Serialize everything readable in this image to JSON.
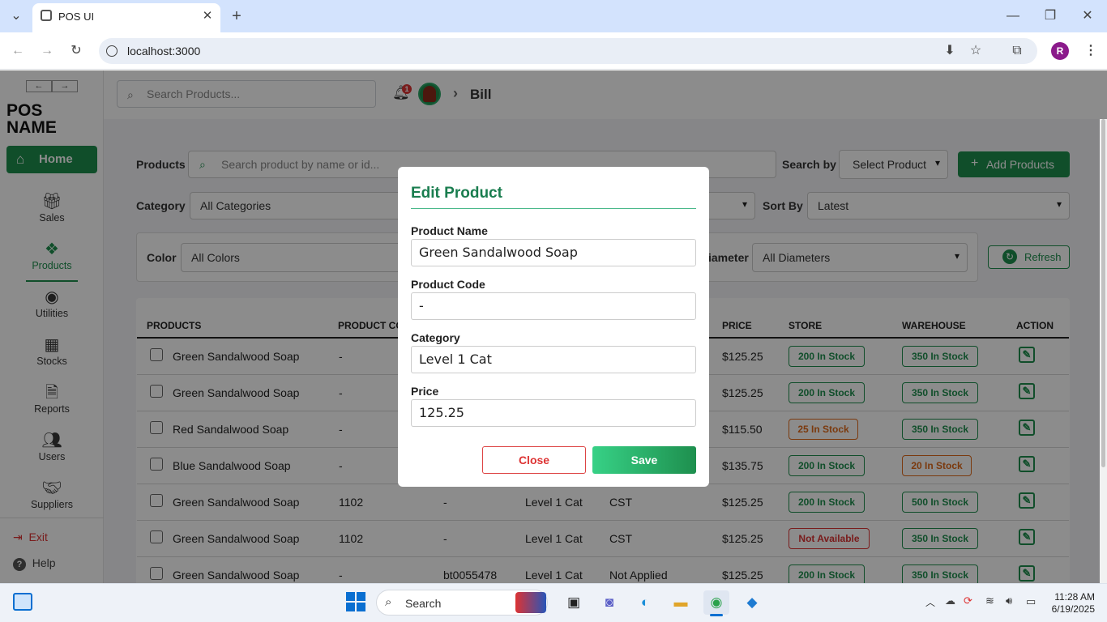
{
  "browser": {
    "tab_title": "POS UI",
    "url": "localhost:3000",
    "profile_initial": "R"
  },
  "sidebar": {
    "logo_line1": "POS",
    "logo_line2": "NAME",
    "home_label": "Home",
    "items": [
      {
        "label": "Sales",
        "icon": "gift-box-icon"
      },
      {
        "label": "Products",
        "icon": "cubes-icon"
      },
      {
        "label": "Utilities",
        "icon": "gauge-icon"
      },
      {
        "label": "Stocks",
        "icon": "boxes-icon"
      },
      {
        "label": "Reports",
        "icon": "document-icon"
      },
      {
        "label": "Users",
        "icon": "users-icon"
      },
      {
        "label": "Suppliers",
        "icon": "handshake-icon"
      }
    ],
    "exit_label": "Exit",
    "help_label": "Help"
  },
  "topbar": {
    "search_placeholder": "Search Products...",
    "notification_count": "1",
    "breadcrumb": "Bill"
  },
  "filters": {
    "products_label": "Products",
    "search_placeholder": "Search product by name or id...",
    "search_by_label": "Search by",
    "search_by_value": "Select Product",
    "add_button": "Add Products",
    "category_label": "Category",
    "category_value": "All Categories",
    "sort_label": "Sort By",
    "sort_value": "Latest",
    "color_label": "Color",
    "color_value": "All Colors",
    "diameter_label": "iameter",
    "diameter_value": "All Diameters",
    "refresh_label": "Refresh"
  },
  "table": {
    "headers": {
      "products": "PRODUCTS",
      "product_code": "PRODUCT CO",
      "price": "PRICE",
      "store": "STORE",
      "warehouse": "WAREHOUSE",
      "action": "ACTION"
    },
    "rows": [
      {
        "name": "Green Sandalwood Soap",
        "code": "-",
        "col3": "",
        "col4": "",
        "col5": "",
        "price": "$125.25",
        "store": "200 In Stock",
        "store_status": "green",
        "warehouse": "350 In Stock",
        "warehouse_status": "green"
      },
      {
        "name": "Green Sandalwood Soap",
        "code": "-",
        "col3": "",
        "col4": "",
        "col5": "",
        "price": "$125.25",
        "store": "200 In Stock",
        "store_status": "green",
        "warehouse": "350 In Stock",
        "warehouse_status": "green"
      },
      {
        "name": "Red Sandalwood Soap",
        "code": "-",
        "col3": "",
        "col4": "",
        "col5": "",
        "price": "$115.50",
        "store": "25 In Stock",
        "store_status": "orange",
        "warehouse": "350 In Stock",
        "warehouse_status": "green"
      },
      {
        "name": "Blue Sandalwood Soap",
        "code": "-",
        "col3": "",
        "col4": "",
        "col5": "",
        "price": "$135.75",
        "store": "200 In Stock",
        "store_status": "green",
        "warehouse": "20 In Stock",
        "warehouse_status": "orange"
      },
      {
        "name": "Green Sandalwood Soap",
        "code": "1102",
        "col3": "-",
        "col4": "Level 1 Cat",
        "col5": "CST",
        "price": "$125.25",
        "store": "200 In Stock",
        "store_status": "green",
        "warehouse": "500 In Stock",
        "warehouse_status": "green"
      },
      {
        "name": "Green Sandalwood Soap",
        "code": "1102",
        "col3": "-",
        "col4": "Level 1 Cat",
        "col5": "CST",
        "price": "$125.25",
        "store": "Not Available",
        "store_status": "red",
        "warehouse": "350 In Stock",
        "warehouse_status": "green"
      },
      {
        "name": "Green Sandalwood Soap",
        "code": "-",
        "col3": "bt0055478",
        "col4": "Level 1 Cat",
        "col5": "Not Applied",
        "price": "$125.25",
        "store": "200 In Stock",
        "store_status": "green",
        "warehouse": "350 In Stock",
        "warehouse_status": "green"
      }
    ]
  },
  "modal": {
    "title": "Edit Product",
    "name_label": "Product Name",
    "name_value": "Green Sandalwood Soap",
    "code_label": "Product Code",
    "code_value": "-",
    "category_label": "Category",
    "category_value": "Level 1 Cat",
    "price_label": "Price",
    "price_value": "125.25",
    "close_label": "Close",
    "save_label": "Save"
  },
  "taskbar": {
    "search_label": "Search",
    "time": "11:28 AM",
    "date": "6/19/2025"
  },
  "colors": {
    "accent": "#1e8f4e",
    "danger": "#d33333",
    "warning": "#e06a1b"
  }
}
